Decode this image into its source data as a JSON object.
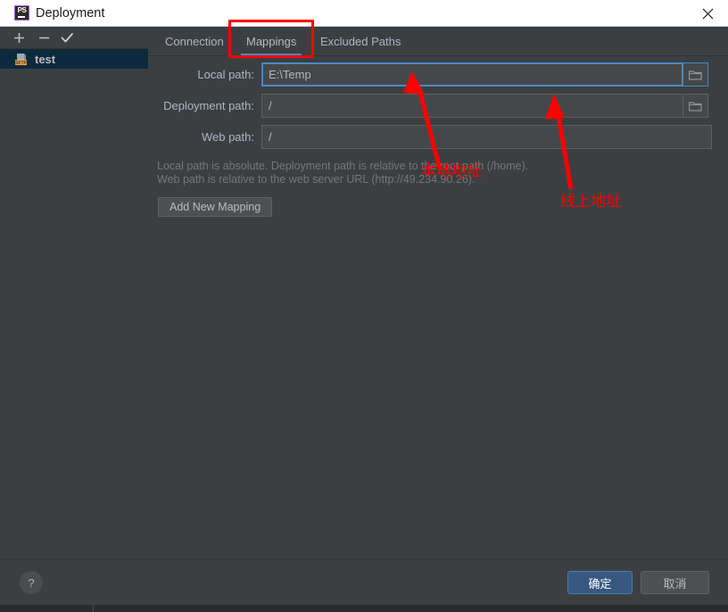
{
  "window": {
    "title": "Deployment",
    "app_icon": "phpstorm-icon",
    "app_icon_text": "PS",
    "close_icon": "close-icon"
  },
  "sidebar": {
    "toolbar": [
      {
        "name": "add-server-button",
        "icon": "plus-icon",
        "label": "+"
      },
      {
        "name": "remove-server-button",
        "icon": "minus-icon",
        "label": "−"
      },
      {
        "name": "set-default-server-button",
        "icon": "check-icon",
        "label": "✓"
      }
    ],
    "servers": [
      {
        "label": "test",
        "icon": "sftp-server-icon",
        "selected": true
      }
    ]
  },
  "tabs": [
    {
      "label": "Connection",
      "selected": false
    },
    {
      "label": "Mappings",
      "selected": true
    },
    {
      "label": "Excluded Paths",
      "selected": false
    }
  ],
  "form": {
    "rows": [
      {
        "label": "Local path:",
        "value": "E:\\Temp",
        "placeholder": "",
        "focused": true,
        "has_browse": true,
        "browse_icon": "folder-icon"
      },
      {
        "label": "Deployment path:",
        "value": "/",
        "placeholder": "",
        "focused": false,
        "has_browse": true,
        "browse_icon": "folder-icon"
      },
      {
        "label": "Web path:",
        "value": "/",
        "placeholder": "",
        "focused": false,
        "has_browse": false,
        "browse_icon": ""
      }
    ],
    "hint_line_1": "Local path is absolute. Deployment path is relative to the root path (/home).",
    "hint_line_2": "Web path is relative to the web server URL (http://49.234.90.26).",
    "add_mapping_label": "Add New Mapping"
  },
  "footer": {
    "help_label": "?",
    "help_icon": "question-mark-icon",
    "ok_label": "确定",
    "cancel_label": "取消"
  },
  "annotations": {
    "highlight_target": "Mappings",
    "note_local": "本地地址",
    "note_online": "线上地址",
    "color": "#fe0000"
  }
}
